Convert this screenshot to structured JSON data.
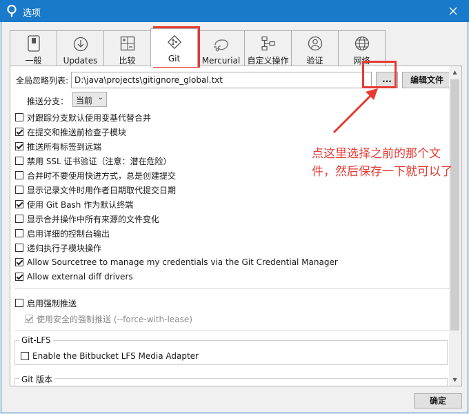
{
  "window": {
    "title": "选项"
  },
  "tabs": [
    {
      "label": "一般",
      "icon": "switch-icon"
    },
    {
      "label": "Updates",
      "icon": "download-icon"
    },
    {
      "label": "比较",
      "icon": "compare-icon"
    },
    {
      "label": "Git",
      "icon": "git-icon",
      "active": true
    },
    {
      "label": "Mercurial",
      "icon": "mercurial-icon"
    },
    {
      "label": "自定义操作",
      "icon": "flowchart-icon"
    },
    {
      "label": "验证",
      "icon": "user-icon"
    },
    {
      "label": "网络",
      "icon": "globe-icon"
    }
  ],
  "git": {
    "ignore_label": "全局忽略列表:",
    "ignore_path": "D:\\java\\projects\\gitignore_global.txt",
    "browse_label": "...",
    "edit_label": "编辑文件",
    "push_branch_label": "推送分支：",
    "push_branch_value": "当前",
    "options": [
      {
        "label": "对跟踪分支默认使用变基代替合并",
        "checked": false
      },
      {
        "label": "在提交和推送前检查子模块",
        "checked": true
      },
      {
        "label": "推送所有标签到远端",
        "checked": true
      },
      {
        "label": "禁用 SSL 证书验证（注意：潜在危险）",
        "checked": false
      },
      {
        "label": "合并时不要使用快进方式，总是创建提交",
        "checked": false
      },
      {
        "label": "显示记录文件时用作者日期取代提交日期",
        "checked": false
      },
      {
        "label": "使用 Git Bash 作为默认终端",
        "checked": true
      },
      {
        "label": "显示合并操作中所有来源的文件变化",
        "checked": false
      },
      {
        "label": "启用详细的控制台输出",
        "checked": false
      },
      {
        "label": "递归执行子模块操作",
        "checked": false
      },
      {
        "label": "Allow Sourcetree to manage my credentials via the Git Credential Manager",
        "checked": true
      },
      {
        "label": "Allow external diff drivers",
        "checked": true
      }
    ],
    "force_push_label": "启用强制推送",
    "safe_force_label": "使用安全的强制推送 (--force-with-lease)",
    "lfs_group_label": "Git-LFS",
    "lfs_option_label": "Enable the Bitbucket LFS Media Adapter",
    "version_group_label": "Git 版本"
  },
  "footer": {
    "ok_label": "确定"
  },
  "annotation": {
    "text": "点这里选择之前的那个文件，然后保存一下就可以了",
    "color": "#e63a32"
  }
}
